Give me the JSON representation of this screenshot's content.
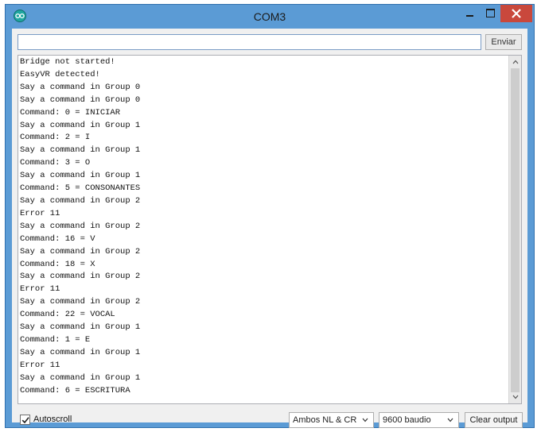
{
  "window": {
    "title": "COM3",
    "icons": {
      "app": "arduino-icon",
      "minimize": "minimize-icon",
      "maximize": "maximize-icon",
      "close": "close-icon"
    }
  },
  "send_bar": {
    "input_value": "",
    "send_label": "Enviar"
  },
  "serial_output": {
    "lines": [
      "Bridge not started!",
      "EasyVR detected!",
      "Say a command in Group 0",
      "Say a command in Group 0",
      "Command: 0 = INICIAR",
      "Say a command in Group 1",
      "Command: 2 = I",
      "Say a command in Group 1",
      "Command: 3 = O",
      "Say a command in Group 1",
      "Command: 5 = CONSONANTES",
      "Say a command in Group 2",
      "Error 11",
      "Say a command in Group 2",
      "Command: 16 = V",
      "Say a command in Group 2",
      "Command: 18 = X",
      "Say a command in Group 2",
      "Error 11",
      "Say a command in Group 2",
      "Command: 22 = VOCAL",
      "Say a command in Group 1",
      "Command: 1 = E",
      "Say a command in Group 1",
      "Error 11",
      "Say a command in Group 1",
      "Command: 6 = ESCRITURA"
    ]
  },
  "footer": {
    "autoscroll_label": "Autoscroll",
    "autoscroll_checked": true,
    "line_ending": "Ambos NL & CR",
    "baud_rate": "9600 baudio",
    "clear_label": "Clear output"
  }
}
